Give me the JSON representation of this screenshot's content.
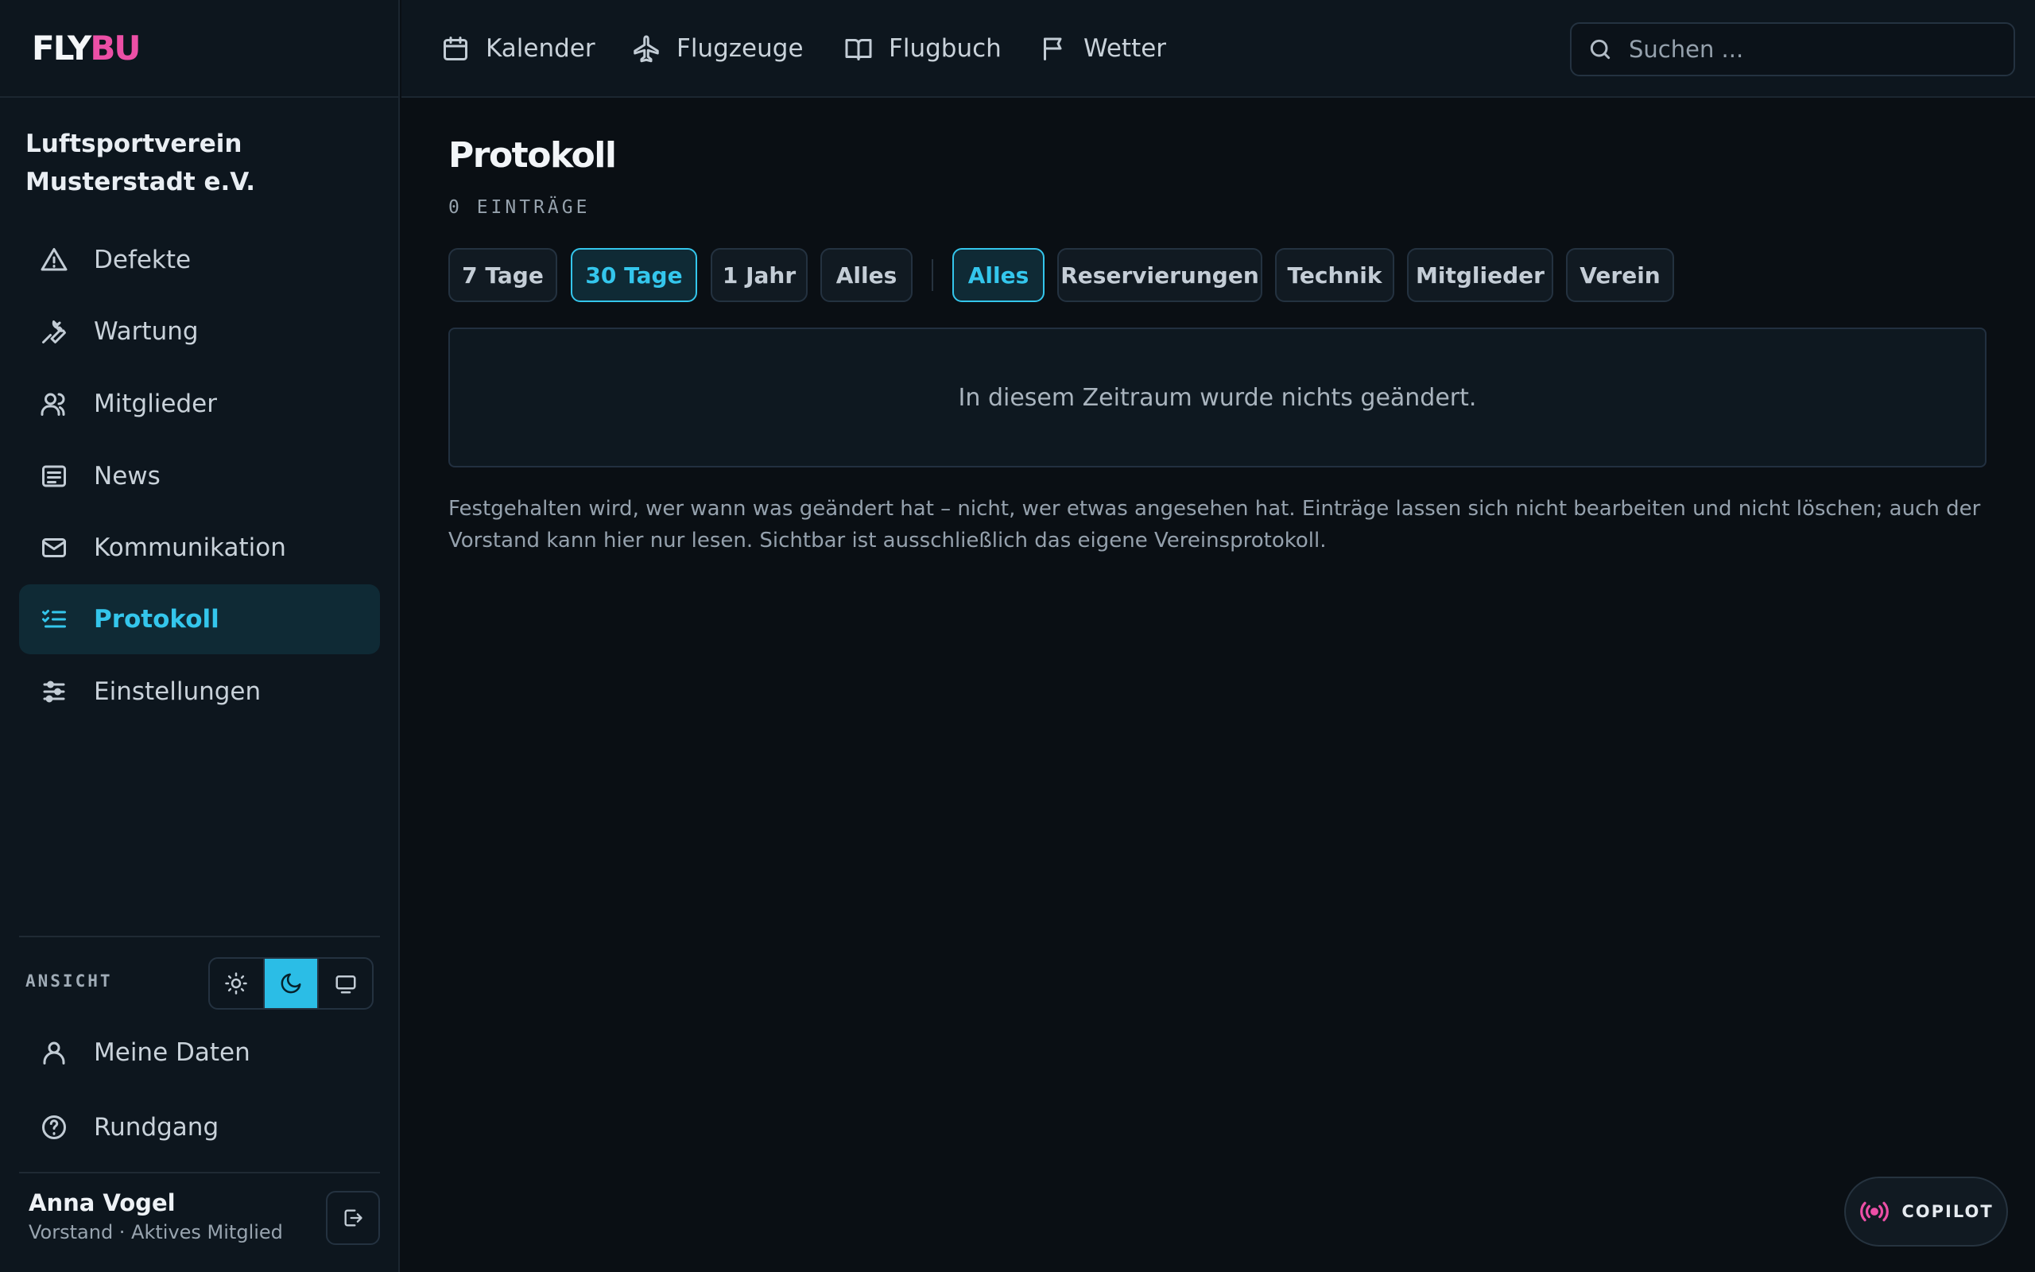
{
  "brand": {
    "part1": "FLY",
    "part2": "BU",
    "accent": "#ec4fa6"
  },
  "org_name": "Luftsportverein Musterstadt e.V.",
  "sidebar": {
    "items": [
      {
        "label": "Defekte",
        "icon": "warning-icon"
      },
      {
        "label": "Wartung",
        "icon": "wrench-icon"
      },
      {
        "label": "Mitglieder",
        "icon": "users-icon"
      },
      {
        "label": "News",
        "icon": "newspaper-icon"
      },
      {
        "label": "Kommunikation",
        "icon": "mail-icon"
      },
      {
        "label": "Protokoll",
        "icon": "list-checks-icon",
        "active": true
      },
      {
        "label": "Einstellungen",
        "icon": "sliders-icon"
      }
    ],
    "view_label": "ANSICHT",
    "theme_options": [
      "light",
      "dark",
      "system"
    ],
    "theme_selected": "dark",
    "bottom_items": [
      {
        "label": "Meine Daten",
        "icon": "user-icon"
      },
      {
        "label": "Rundgang",
        "icon": "help-circle-icon"
      }
    ],
    "user": {
      "name": "Anna Vogel",
      "role": "Vorstand · Aktives Mitglied"
    }
  },
  "topnav": {
    "links": [
      {
        "label": "Kalender",
        "icon": "calendar-icon"
      },
      {
        "label": "Flugzeuge",
        "icon": "plane-icon"
      },
      {
        "label": "Flugbuch",
        "icon": "book-icon"
      },
      {
        "label": "Wetter",
        "icon": "flag-icon"
      }
    ],
    "search_placeholder": "Suchen ..."
  },
  "main": {
    "title": "Protokoll",
    "count": "0 EINTRÄGE",
    "time_filters": [
      {
        "label": "7 Tage"
      },
      {
        "label": "30 Tage",
        "active": true
      },
      {
        "label": "1 Jahr"
      },
      {
        "label": "Alles"
      }
    ],
    "category_filters": [
      {
        "label": "Alles",
        "active": true
      },
      {
        "label": "Reservierungen"
      },
      {
        "label": "Technik"
      },
      {
        "label": "Mitglieder"
      },
      {
        "label": "Verein"
      }
    ],
    "empty_message": "In diesem Zeitraum wurde nichts geändert.",
    "note": "Festgehalten wird, wer wann was geändert hat – nicht, wer etwas angesehen hat. Einträge lassen sich nicht bearbeiten und nicht löschen; auch der Vorstand kann hier nur lesen. Sichtbar ist ausschließlich das eigene Vereinsprotokoll."
  },
  "copilot_label": "COPILOT",
  "colors": {
    "accent": "#34c6ec",
    "background": "#0a0f14",
    "panel": "#0d161e"
  }
}
